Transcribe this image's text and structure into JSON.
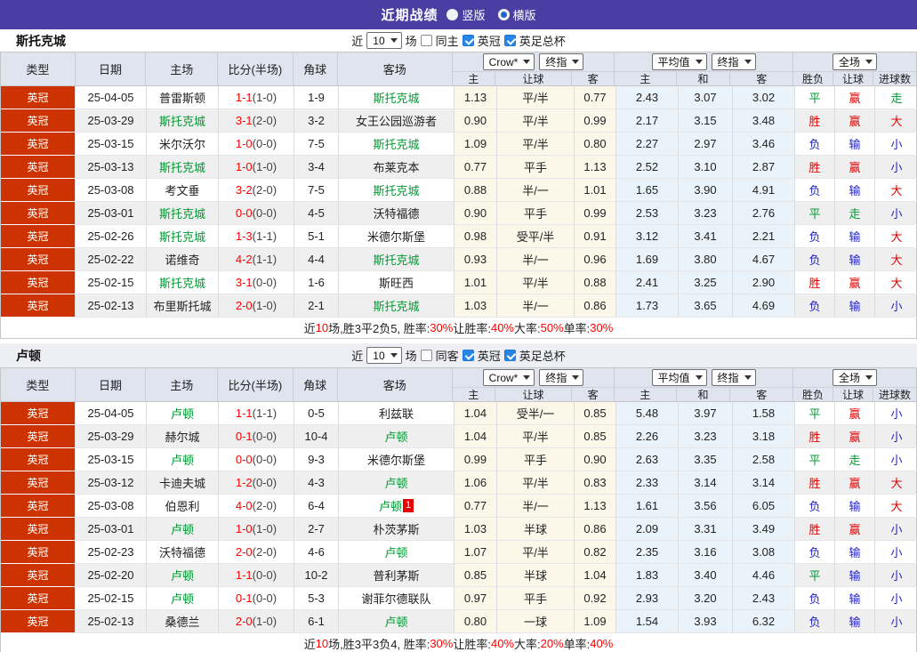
{
  "titlebar": {
    "title": "近期战绩",
    "radio_vertical": "竖版",
    "radio_horizontal": "横版"
  },
  "columns": {
    "left": [
      "类型",
      "日期",
      "主场",
      "比分(半场)",
      "角球",
      "客场"
    ],
    "odds": [
      "主",
      "让球",
      "客"
    ],
    "avg": [
      "主",
      "和",
      "客"
    ],
    "result": [
      "胜负",
      "让球",
      "进球数"
    ],
    "dropdowns": {
      "bookmaker": "Crow*",
      "final1": "终指",
      "average": "平均值",
      "final2": "终指",
      "full": "全场"
    }
  },
  "colors": {
    "accent_purple": "#4b3ea3",
    "league_red": "#cc3300",
    "team_green": "#009933",
    "win_red": "#e60000",
    "lose_blue": "#2222cc",
    "draw_green": "#009933",
    "score_red": "#ff0000"
  },
  "sections": [
    {
      "team": "斯托克城",
      "filter": {
        "near": "近",
        "count": "10",
        "games": "场",
        "same": "同主",
        "league": "英冠",
        "cup": "英足总杯"
      },
      "rows": [
        {
          "lg": "英冠",
          "date": "25-04-05",
          "home": "普雷斯顿",
          "hg": 0,
          "score": "1-1",
          "half": "(1-0)",
          "cor": "1-9",
          "away": "斯托克城",
          "ag": 1,
          "card": "",
          "o": [
            "1.13",
            "平/半",
            "0.77"
          ],
          "a": [
            "2.43",
            "3.07",
            "3.02"
          ],
          "res": [
            [
              "平",
              "g"
            ],
            [
              "赢",
              "r"
            ],
            [
              "走",
              "g"
            ]
          ]
        },
        {
          "lg": "英冠",
          "date": "25-03-29",
          "home": "斯托克城",
          "hg": 1,
          "score": "3-1",
          "half": "(2-0)",
          "cor": "3-2",
          "away": "女王公园巡游者",
          "ag": 0,
          "card": "",
          "o": [
            "0.90",
            "平/半",
            "0.99"
          ],
          "a": [
            "2.17",
            "3.15",
            "3.48"
          ],
          "res": [
            [
              "胜",
              "r"
            ],
            [
              "赢",
              "r"
            ],
            [
              "大",
              "r"
            ]
          ]
        },
        {
          "lg": "英冠",
          "date": "25-03-15",
          "home": "米尔沃尔",
          "hg": 0,
          "score": "1-0",
          "half": "(0-0)",
          "cor": "7-5",
          "away": "斯托克城",
          "ag": 1,
          "card": "",
          "o": [
            "1.09",
            "平/半",
            "0.80"
          ],
          "a": [
            "2.27",
            "2.97",
            "3.46"
          ],
          "res": [
            [
              "负",
              "b"
            ],
            [
              "输",
              "b"
            ],
            [
              "小",
              "b"
            ]
          ]
        },
        {
          "lg": "英冠",
          "date": "25-03-13",
          "home": "斯托克城",
          "hg": 1,
          "score": "1-0",
          "half": "(1-0)",
          "cor": "3-4",
          "away": "布莱克本",
          "ag": 0,
          "card": "",
          "o": [
            "0.77",
            "平手",
            "1.13"
          ],
          "a": [
            "2.52",
            "3.10",
            "2.87"
          ],
          "res": [
            [
              "胜",
              "r"
            ],
            [
              "赢",
              "r"
            ],
            [
              "小",
              "b"
            ]
          ]
        },
        {
          "lg": "英冠",
          "date": "25-03-08",
          "home": "考文垂",
          "hg": 0,
          "score": "3-2",
          "half": "(2-0)",
          "cor": "7-5",
          "away": "斯托克城",
          "ag": 1,
          "card": "",
          "o": [
            "0.88",
            "半/一",
            "1.01"
          ],
          "a": [
            "1.65",
            "3.90",
            "4.91"
          ],
          "res": [
            [
              "负",
              "b"
            ],
            [
              "输",
              "b"
            ],
            [
              "大",
              "r"
            ]
          ]
        },
        {
          "lg": "英冠",
          "date": "25-03-01",
          "home": "斯托克城",
          "hg": 1,
          "score": "0-0",
          "half": "(0-0)",
          "cor": "4-5",
          "away": "沃特福德",
          "ag": 0,
          "card": "",
          "o": [
            "0.90",
            "平手",
            "0.99"
          ],
          "a": [
            "2.53",
            "3.23",
            "2.76"
          ],
          "res": [
            [
              "平",
              "g"
            ],
            [
              "走",
              "g"
            ],
            [
              "小",
              "b"
            ]
          ]
        },
        {
          "lg": "英冠",
          "date": "25-02-26",
          "home": "斯托克城",
          "hg": 1,
          "score": "1-3",
          "half": "(1-1)",
          "cor": "5-1",
          "away": "米德尔斯堡",
          "ag": 0,
          "card": "",
          "o": [
            "0.98",
            "受平/半",
            "0.91"
          ],
          "a": [
            "3.12",
            "3.41",
            "2.21"
          ],
          "res": [
            [
              "负",
              "b"
            ],
            [
              "输",
              "b"
            ],
            [
              "大",
              "r"
            ]
          ]
        },
        {
          "lg": "英冠",
          "date": "25-02-22",
          "home": "诺维奇",
          "hg": 0,
          "score": "4-2",
          "half": "(1-1)",
          "cor": "4-4",
          "away": "斯托克城",
          "ag": 1,
          "card": "",
          "o": [
            "0.93",
            "半/一",
            "0.96"
          ],
          "a": [
            "1.69",
            "3.80",
            "4.67"
          ],
          "res": [
            [
              "负",
              "b"
            ],
            [
              "输",
              "b"
            ],
            [
              "大",
              "r"
            ]
          ]
        },
        {
          "lg": "英冠",
          "date": "25-02-15",
          "home": "斯托克城",
          "hg": 1,
          "score": "3-1",
          "half": "(0-0)",
          "cor": "1-6",
          "away": "斯旺西",
          "ag": 0,
          "card": "",
          "o": [
            "1.01",
            "平/半",
            "0.88"
          ],
          "a": [
            "2.41",
            "3.25",
            "2.90"
          ],
          "res": [
            [
              "胜",
              "r"
            ],
            [
              "赢",
              "r"
            ],
            [
              "大",
              "r"
            ]
          ]
        },
        {
          "lg": "英冠",
          "date": "25-02-13",
          "home": "布里斯托城",
          "hg": 0,
          "score": "2-0",
          "half": "(1-0)",
          "cor": "2-1",
          "away": "斯托克城",
          "ag": 1,
          "card": "",
          "o": [
            "1.03",
            "半/一",
            "0.86"
          ],
          "a": [
            "1.73",
            "3.65",
            "4.69"
          ],
          "res": [
            [
              "负",
              "b"
            ],
            [
              "输",
              "b"
            ],
            [
              "小",
              "b"
            ]
          ]
        }
      ],
      "summary": [
        {
          "t": "近"
        },
        {
          "t": "10",
          "r": 1
        },
        {
          "t": "场,胜3平2负5, 胜率:"
        },
        {
          "t": "30%",
          "r": 1
        },
        {
          "t": " 让胜率:"
        },
        {
          "t": "40%",
          "r": 1
        },
        {
          "t": " 大率:"
        },
        {
          "t": "50%",
          "r": 1
        },
        {
          "t": " 单率:"
        },
        {
          "t": "30%",
          "r": 1
        }
      ]
    },
    {
      "team": "卢顿",
      "filter": {
        "near": "近",
        "count": "10",
        "games": "场",
        "same": "同客",
        "league": "英冠",
        "cup": "英足总杯"
      },
      "rows": [
        {
          "lg": "英冠",
          "date": "25-04-05",
          "home": "卢顿",
          "hg": 1,
          "score": "1-1",
          "half": "(1-1)",
          "cor": "0-5",
          "away": "利兹联",
          "ag": 0,
          "card": "",
          "o": [
            "1.04",
            "受半/一",
            "0.85"
          ],
          "a": [
            "5.48",
            "3.97",
            "1.58"
          ],
          "res": [
            [
              "平",
              "g"
            ],
            [
              "赢",
              "r"
            ],
            [
              "小",
              "b"
            ]
          ]
        },
        {
          "lg": "英冠",
          "date": "25-03-29",
          "home": "赫尔城",
          "hg": 0,
          "score": "0-1",
          "half": "(0-0)",
          "cor": "10-4",
          "away": "卢顿",
          "ag": 1,
          "card": "",
          "o": [
            "1.04",
            "平/半",
            "0.85"
          ],
          "a": [
            "2.26",
            "3.23",
            "3.18"
          ],
          "res": [
            [
              "胜",
              "r"
            ],
            [
              "赢",
              "r"
            ],
            [
              "小",
              "b"
            ]
          ]
        },
        {
          "lg": "英冠",
          "date": "25-03-15",
          "home": "卢顿",
          "hg": 1,
          "score": "0-0",
          "half": "(0-0)",
          "cor": "9-3",
          "away": "米德尔斯堡",
          "ag": 0,
          "card": "",
          "o": [
            "0.99",
            "平手",
            "0.90"
          ],
          "a": [
            "2.63",
            "3.35",
            "2.58"
          ],
          "res": [
            [
              "平",
              "g"
            ],
            [
              "走",
              "g"
            ],
            [
              "小",
              "b"
            ]
          ]
        },
        {
          "lg": "英冠",
          "date": "25-03-12",
          "home": "卡迪夫城",
          "hg": 0,
          "score": "1-2",
          "half": "(0-0)",
          "cor": "4-3",
          "away": "卢顿",
          "ag": 1,
          "card": "",
          "o": [
            "1.06",
            "平/半",
            "0.83"
          ],
          "a": [
            "2.33",
            "3.14",
            "3.14"
          ],
          "res": [
            [
              "胜",
              "r"
            ],
            [
              "赢",
              "r"
            ],
            [
              "大",
              "r"
            ]
          ]
        },
        {
          "lg": "英冠",
          "date": "25-03-08",
          "home": "伯恩利",
          "hg": 0,
          "score": "4-0",
          "half": "(2-0)",
          "cor": "6-4",
          "away": "卢顿",
          "ag": 1,
          "card": "1",
          "o": [
            "0.77",
            "半/一",
            "1.13"
          ],
          "a": [
            "1.61",
            "3.56",
            "6.05"
          ],
          "res": [
            [
              "负",
              "b"
            ],
            [
              "输",
              "b"
            ],
            [
              "大",
              "r"
            ]
          ]
        },
        {
          "lg": "英冠",
          "date": "25-03-01",
          "home": "卢顿",
          "hg": 1,
          "score": "1-0",
          "half": "(1-0)",
          "cor": "2-7",
          "away": "朴茨茅斯",
          "ag": 0,
          "card": "",
          "o": [
            "1.03",
            "半球",
            "0.86"
          ],
          "a": [
            "2.09",
            "3.31",
            "3.49"
          ],
          "res": [
            [
              "胜",
              "r"
            ],
            [
              "赢",
              "r"
            ],
            [
              "小",
              "b"
            ]
          ]
        },
        {
          "lg": "英冠",
          "date": "25-02-23",
          "home": "沃特福德",
          "hg": 0,
          "score": "2-0",
          "half": "(2-0)",
          "cor": "4-6",
          "away": "卢顿",
          "ag": 1,
          "card": "",
          "o": [
            "1.07",
            "平/半",
            "0.82"
          ],
          "a": [
            "2.35",
            "3.16",
            "3.08"
          ],
          "res": [
            [
              "负",
              "b"
            ],
            [
              "输",
              "b"
            ],
            [
              "小",
              "b"
            ]
          ]
        },
        {
          "lg": "英冠",
          "date": "25-02-20",
          "home": "卢顿",
          "hg": 1,
          "score": "1-1",
          "half": "(0-0)",
          "cor": "10-2",
          "away": "普利茅斯",
          "ag": 0,
          "card": "",
          "o": [
            "0.85",
            "半球",
            "1.04"
          ],
          "a": [
            "1.83",
            "3.40",
            "4.46"
          ],
          "res": [
            [
              "平",
              "g"
            ],
            [
              "输",
              "b"
            ],
            [
              "小",
              "b"
            ]
          ]
        },
        {
          "lg": "英冠",
          "date": "25-02-15",
          "home": "卢顿",
          "hg": 1,
          "score": "0-1",
          "half": "(0-0)",
          "cor": "5-3",
          "away": "谢菲尔德联队",
          "ag": 0,
          "card": "",
          "o": [
            "0.97",
            "平手",
            "0.92"
          ],
          "a": [
            "2.93",
            "3.20",
            "2.43"
          ],
          "res": [
            [
              "负",
              "b"
            ],
            [
              "输",
              "b"
            ],
            [
              "小",
              "b"
            ]
          ]
        },
        {
          "lg": "英冠",
          "date": "25-02-13",
          "home": "桑德兰",
          "hg": 0,
          "score": "2-0",
          "half": "(1-0)",
          "cor": "6-1",
          "away": "卢顿",
          "ag": 1,
          "card": "",
          "o": [
            "0.80",
            "一球",
            "1.09"
          ],
          "a": [
            "1.54",
            "3.93",
            "6.32"
          ],
          "res": [
            [
              "负",
              "b"
            ],
            [
              "输",
              "b"
            ],
            [
              "小",
              "b"
            ]
          ]
        }
      ],
      "summary": [
        {
          "t": "近"
        },
        {
          "t": "10",
          "r": 1
        },
        {
          "t": "场,胜3平3负4, 胜率:"
        },
        {
          "t": "30%",
          "r": 1
        },
        {
          "t": " 让胜率:"
        },
        {
          "t": "40%",
          "r": 1
        },
        {
          "t": " 大率:"
        },
        {
          "t": "20%",
          "r": 1
        },
        {
          "t": " 单率:"
        },
        {
          "t": "40%",
          "r": 1
        }
      ]
    }
  ]
}
